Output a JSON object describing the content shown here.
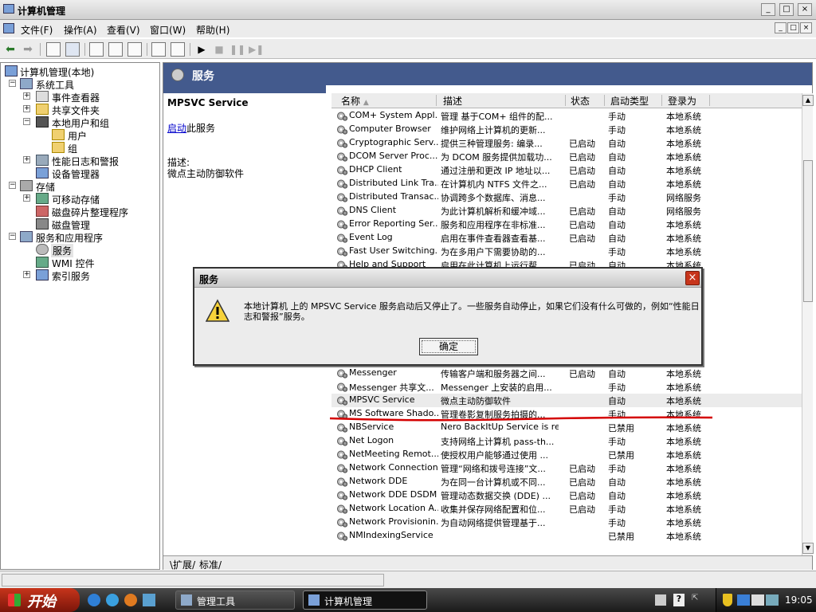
{
  "window": {
    "title": "计算机管理",
    "min": "_",
    "max": "□",
    "close": "×"
  },
  "menu": [
    "文件(F)",
    "操作(A)",
    "查看(V)",
    "窗口(W)",
    "帮助(H)"
  ],
  "tree": {
    "root": "计算机管理(本地)",
    "items": [
      {
        "label": "系统工具"
      },
      {
        "label": "事件查看器"
      },
      {
        "label": "共享文件夹"
      },
      {
        "label": "本地用户和组"
      },
      {
        "label": "用户"
      },
      {
        "label": "组"
      },
      {
        "label": "性能日志和警报"
      },
      {
        "label": "设备管理器"
      },
      {
        "label": "存储"
      },
      {
        "label": "可移动存储"
      },
      {
        "label": "磁盘碎片整理程序"
      },
      {
        "label": "磁盘管理"
      },
      {
        "label": "服务和应用程序"
      },
      {
        "label": "服务"
      },
      {
        "label": "WMI 控件"
      },
      {
        "label": "索引服务"
      }
    ]
  },
  "panel": {
    "header": "服务",
    "service_name": "MPSVC Service",
    "start_link": "启动",
    "start_suffix": "此服务",
    "desc_label": "描述:",
    "desc_value": "微点主动防御软件"
  },
  "columns": [
    "名称",
    "描述",
    "状态",
    "启动类型",
    "登录为"
  ],
  "rows": [
    [
      "COM+ System Appl...",
      "管理 基于COM+ 组件的配...",
      "",
      "手动",
      "本地系统"
    ],
    [
      "Computer Browser",
      "维护网络上计算机的更新...",
      "",
      "手动",
      "本地系统"
    ],
    [
      "Cryptographic Serv...",
      "提供三种管理服务: 编录...",
      "已启动",
      "自动",
      "本地系统"
    ],
    [
      "DCOM Server Proc...",
      "为 DCOM 服务提供加载功...",
      "已启动",
      "自动",
      "本地系统"
    ],
    [
      "DHCP Client",
      "通过注册和更改 IP 地址以...",
      "已启动",
      "自动",
      "本地系统"
    ],
    [
      "Distributed Link Tra...",
      "在计算机内 NTFS 文件之...",
      "已启动",
      "自动",
      "本地系统"
    ],
    [
      "Distributed Transac...",
      "协调跨多个数据库、消息...",
      "",
      "手动",
      "网络服务"
    ],
    [
      "DNS Client",
      "为此计算机解析和缓冲域...",
      "已启动",
      "自动",
      "网络服务"
    ],
    [
      "Error Reporting Ser...",
      "服务和应用程序在非标准...",
      "已启动",
      "自动",
      "本地系统"
    ],
    [
      "Event Log",
      "启用在事件查看器查看基...",
      "已启动",
      "自动",
      "本地系统"
    ],
    [
      "Fast User Switching...",
      "为在多用户下需要协助的...",
      "",
      "手动",
      "本地系统"
    ],
    [
      "Help and Support",
      "启用在此计算机上运行帮...",
      "已启动",
      "自动",
      "本地系统"
    ],
    [
      "",
      "",
      "",
      "",
      ""
    ],
    [
      "",
      "",
      "",
      "",
      ""
    ],
    [
      "",
      "",
      "",
      "",
      ""
    ],
    [
      "",
      "",
      "",
      "",
      ""
    ],
    [
      "",
      "",
      "",
      "",
      ""
    ],
    [
      "",
      "",
      "",
      "",
      ""
    ],
    [
      "Logical Disk Manag...",
      "配置硬盘驱动器和卷。此...",
      "",
      "手动",
      "本地系统"
    ],
    [
      "Messenger",
      "传输客户端和服务器之间...",
      "已启动",
      "自动",
      "本地系统"
    ],
    [
      "Messenger 共享文...",
      "Messenger 上安装的启用...",
      "",
      "手动",
      "本地系统"
    ],
    [
      "MPSVC Service",
      "微点主动防御软件",
      "",
      "自动",
      "本地系统"
    ],
    [
      "MS Software Shado...",
      "管理卷影复制服务拍摄的...",
      "",
      "手动",
      "本地系统"
    ],
    [
      "NBService",
      "Nero BackItUp Service is res...",
      "",
      "已禁用",
      "本地系统"
    ],
    [
      "Net Logon",
      "支持网络上计算机 pass-th...",
      "",
      "手动",
      "本地系统"
    ],
    [
      "NetMeeting Remot...",
      "使授权用户能够通过使用 ...",
      "",
      "已禁用",
      "本地系统"
    ],
    [
      "Network Connections",
      "管理“网络和拨号连接”文...",
      "已启动",
      "手动",
      "本地系统"
    ],
    [
      "Network DDE",
      "为在同一台计算机或不同...",
      "已启动",
      "自动",
      "本地系统"
    ],
    [
      "Network DDE DSDM",
      "管理动态数据交换 (DDE) ...",
      "已启动",
      "自动",
      "本地系统"
    ],
    [
      "Network Location A...",
      "收集并保存网络配置和位...",
      "已启动",
      "手动",
      "本地系统"
    ],
    [
      "Network Provisionin...",
      "为自动网络提供管理基于...",
      "",
      "手动",
      "本地系统"
    ],
    [
      "NMIndexingService",
      "",
      "",
      "已禁用",
      "本地系统"
    ]
  ],
  "tabs": [
    "扩展",
    "标准"
  ],
  "dialog": {
    "title": "服务",
    "message": "本地计算机 上的 MPSVC Service 服务启动后又停止了。一些服务自动停止，如果它们没有什么可做的，例如“性能日志和警报”服务。",
    "ok": "确定",
    "close": "×"
  },
  "taskbar": {
    "start": "开始",
    "tasks": [
      "管理工具",
      "计算机管理"
    ],
    "clock": "19:05"
  },
  "colors": {
    "header_bg": "#435a8d",
    "start": "#c7351b",
    "highlight_line": "#d40000"
  }
}
